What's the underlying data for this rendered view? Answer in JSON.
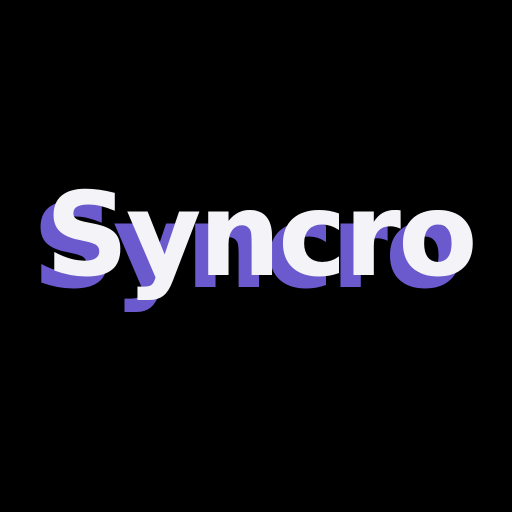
{
  "logo": {
    "text": "Syncro",
    "text_color": "#F4F4F8",
    "shadow_color": "#6A5ACD",
    "background_color": "#000000"
  }
}
